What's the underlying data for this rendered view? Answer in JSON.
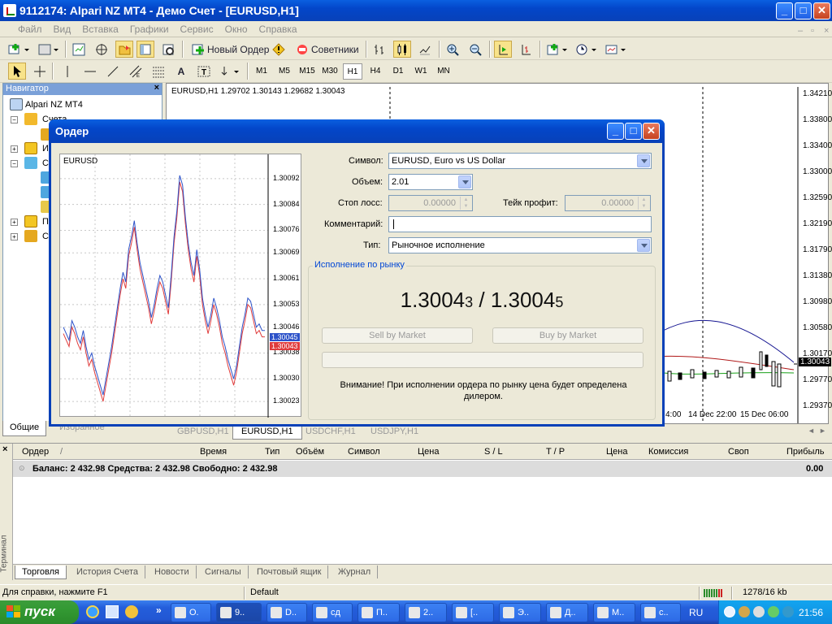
{
  "window": {
    "title": "9112174: Alpari NZ MT4 - Демо Счет - [EURUSD,H1]"
  },
  "menu": [
    "Файл",
    "Вид",
    "Вставка",
    "Графики",
    "Сервис",
    "Окно",
    "Справка"
  ],
  "toolbar1": {
    "new_order": "Новый Ордер",
    "advisors": "Советники"
  },
  "timeframes": [
    "M1",
    "M5",
    "M15",
    "M30",
    "H1",
    "H4",
    "D1",
    "W1",
    "MN"
  ],
  "active_timeframe": "H1",
  "navigator": {
    "title": "Навигатор",
    "root": "Alpari NZ MT4",
    "items": [
      "Счета",
      "Ин",
      "Со",
      "По",
      "Ск"
    ],
    "tabs": [
      "Общие",
      "Избранное"
    ]
  },
  "chart": {
    "header": "EURUSD,H1  1.29702 1.30143 1.29682 1.30043",
    "price_scale": [
      "1.34210",
      "1.33800",
      "1.33400",
      "1.33000",
      "1.32590",
      "1.32190",
      "1.31790",
      "1.31380",
      "1.30980",
      "1.30580",
      "1.30170",
      "1.29770",
      "1.29370"
    ],
    "current_price": "1.30043",
    "time_labels": [
      "4:00",
      "14 Dec 22:00",
      "15 Dec 06:00"
    ],
    "tabs": [
      "GBPUSD,H1",
      "EURUSD,H1",
      "USDCHF,H1",
      "USDJPY,H1"
    ],
    "active_tab": "EURUSD,H1"
  },
  "dialog": {
    "title": "Ордер",
    "symbol_label": "Символ:",
    "symbol_value": "EURUSD, Euro vs US Dollar",
    "volume_label": "Объем:",
    "volume_value": "2.01",
    "sl_label": "Стоп лосс:",
    "sl_value": "0.00000",
    "tp_label": "Тейк профит:",
    "tp_value": "0.00000",
    "comment_label": "Комментарий:",
    "comment_value": "",
    "type_label": "Тип:",
    "type_value": "Рыночное исполнение",
    "group_label": "Исполнение по рынку",
    "bid_main": "1.3004",
    "bid_small": "3",
    "price_sep": " / ",
    "ask_main": "1.3004",
    "ask_small": "5",
    "sell_button": "Sell by Market",
    "buy_button": "Buy by Market",
    "warning": "Внимание! При исполнении ордера по рынку цена будет определена дилером.",
    "minichart": {
      "symbol": "EURUSD",
      "scale": [
        "1.30092",
        "1.30084",
        "1.30076",
        "1.30069",
        "1.30061",
        "1.30053",
        "1.30046",
        "1.30038",
        "1.30030",
        "1.30023"
      ],
      "ask_tag": "1.30045",
      "bid_tag": "1.30043",
      "ask_series": [
        1.30046,
        1.30044,
        1.30042,
        1.30048,
        1.30046,
        1.30043,
        1.30041,
        1.30045,
        1.3004,
        1.30036,
        1.30038,
        1.30034,
        1.30031,
        1.30028,
        1.30025,
        1.3003,
        1.30035,
        1.3004,
        1.30046,
        1.30052,
        1.30058,
        1.30063,
        1.3006,
        1.3007,
        1.30074,
        1.30079,
        1.30072,
        1.30066,
        1.30062,
        1.30058,
        1.30054,
        1.30049,
        1.30053,
        1.30058,
        1.30062,
        1.3006,
        1.30056,
        1.30052,
        1.30062,
        1.30074,
        1.30082,
        1.30093,
        1.3009,
        1.3008,
        1.30072,
        1.30066,
        1.30062,
        1.3007,
        1.30064,
        1.30055,
        1.3005,
        1.30046,
        1.3005,
        1.30055,
        1.30052,
        1.30048,
        1.30043,
        1.3004,
        1.30036,
        1.30033,
        1.3003,
        1.30034,
        1.3004,
        1.30046,
        1.3005,
        1.30055,
        1.30054,
        1.3005,
        1.30046,
        1.30047,
        1.30045,
        1.30045
      ],
      "bid_series": [
        1.30044,
        1.30042,
        1.3004,
        1.30046,
        1.30044,
        1.30041,
        1.30039,
        1.30043,
        1.30038,
        1.30034,
        1.30036,
        1.30032,
        1.30029,
        1.30026,
        1.30023,
        1.30028,
        1.30033,
        1.30038,
        1.30044,
        1.3005,
        1.30056,
        1.30061,
        1.30058,
        1.30068,
        1.30072,
        1.30077,
        1.3007,
        1.30064,
        1.3006,
        1.30056,
        1.30052,
        1.30047,
        1.30051,
        1.30056,
        1.3006,
        1.30058,
        1.30054,
        1.3005,
        1.3006,
        1.30072,
        1.3008,
        1.30091,
        1.30088,
        1.30078,
        1.3007,
        1.30064,
        1.3006,
        1.30068,
        1.30062,
        1.30053,
        1.30048,
        1.30044,
        1.30048,
        1.30053,
        1.3005,
        1.30046,
        1.30041,
        1.30038,
        1.30034,
        1.30031,
        1.30028,
        1.30032,
        1.30038,
        1.30044,
        1.30048,
        1.30053,
        1.30052,
        1.30048,
        1.30044,
        1.30045,
        1.30043,
        1.30043
      ],
      "ylim": [
        1.3002,
        1.30096
      ]
    }
  },
  "terminal": {
    "side_label": "Терминал",
    "columns": [
      "Ордер",
      "/",
      "Время",
      "Тип",
      "Объём",
      "Символ",
      "Цена",
      "S / L",
      "T / P",
      "Цена",
      "Комиссия",
      "Своп",
      "Прибыль"
    ],
    "balance_line": "Баланс: 2 432.98  Средства: 2 432.98  Свободно: 2 432.98",
    "profit": "0.00",
    "tabs": [
      "Торговля",
      "История Счета",
      "Новости",
      "Сигналы",
      "Почтовый ящик",
      "Журнал"
    ]
  },
  "status": {
    "help": "Для справки, нажмите F1",
    "profile": "Default",
    "traffic": "1278/16 kb"
  },
  "taskbar": {
    "start": "пуск",
    "tasks": [
      "О.",
      "9..",
      "D..",
      "сд",
      "П..",
      "2..",
      "[..",
      "Э..",
      "Д..",
      "М..",
      "с.."
    ],
    "lang": "RU",
    "clock": "21:56"
  }
}
